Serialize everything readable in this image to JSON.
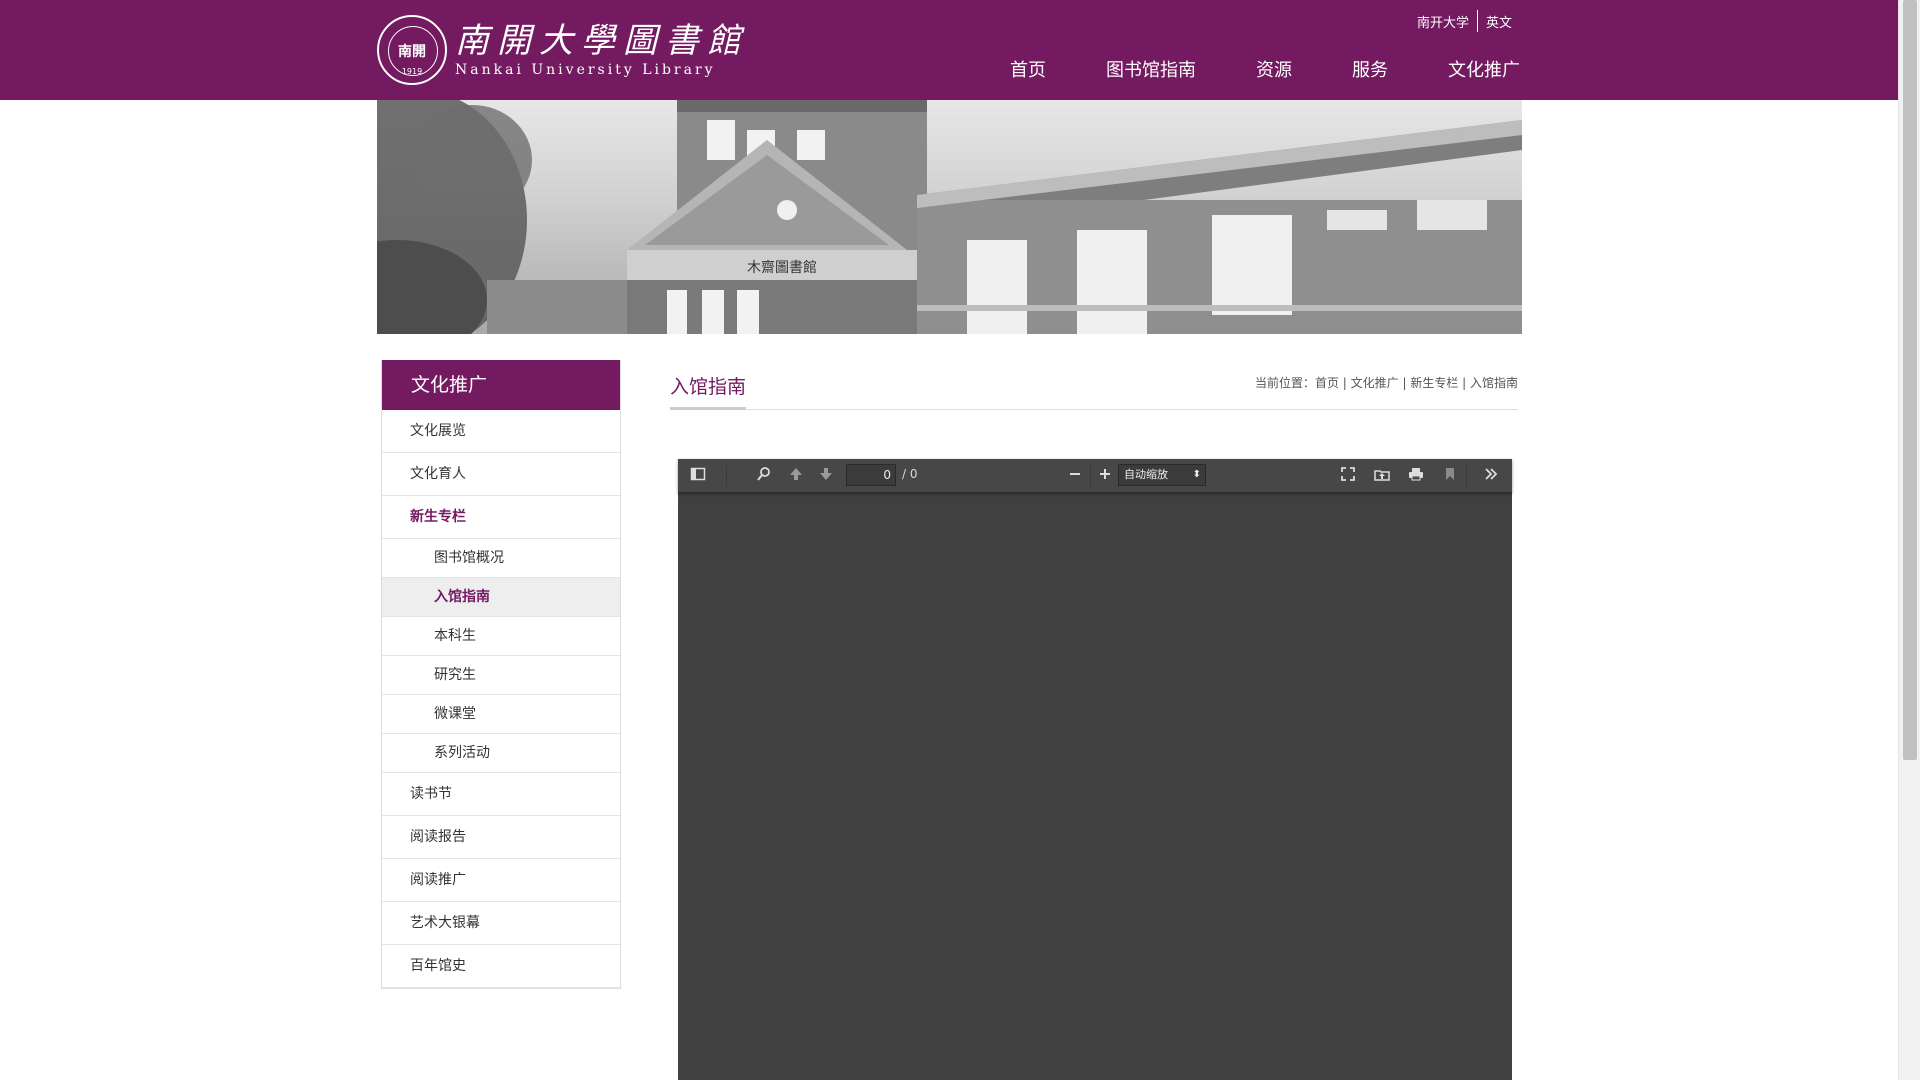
{
  "header": {
    "logo_seal_text": "南開",
    "logo_seal_year": "1919",
    "logo_cn": "南開大學圖書館",
    "logo_en": "Nankai University Library",
    "top_links": [
      "南开大学",
      "英文"
    ],
    "nav": [
      "首页",
      "图书馆指南",
      "资源",
      "服务",
      "文化推广"
    ]
  },
  "banner": {
    "sign_text": "木齋圖書館"
  },
  "sidebar": {
    "title": "文化推广",
    "items": [
      {
        "label": "文化展览"
      },
      {
        "label": "文化育人"
      },
      {
        "label": "新生专栏",
        "active": true
      },
      {
        "label": "读书节"
      },
      {
        "label": "阅读报告"
      },
      {
        "label": "阅读推广"
      },
      {
        "label": "艺术大银幕"
      },
      {
        "label": "百年馆史"
      }
    ],
    "sub_items": [
      {
        "label": "图书馆概况"
      },
      {
        "label": "入馆指南",
        "current": true
      },
      {
        "label": "本科生"
      },
      {
        "label": "研究生"
      },
      {
        "label": "微课堂"
      },
      {
        "label": "系列活动"
      }
    ]
  },
  "main": {
    "title": "入馆指南",
    "breadcrumb": "当前位置：首页 | 文化推广 | 新生专栏 | 入馆指南"
  },
  "viewer": {
    "page_value": "0",
    "page_count": "/ 0",
    "zoom": "自动缩放",
    "icons": [
      "sidebar-toggle-icon",
      "search-icon",
      "previous-page-icon",
      "next-page-icon",
      "zoom-out-icon",
      "zoom-in-icon",
      "presentation-mode-icon",
      "open-file-icon",
      "print-icon",
      "bookmark-icon",
      "tools-icon"
    ]
  },
  "colors": {
    "brand": "#731a60",
    "viewer_bg": "#404040",
    "toolbar_bg": "#474747"
  }
}
